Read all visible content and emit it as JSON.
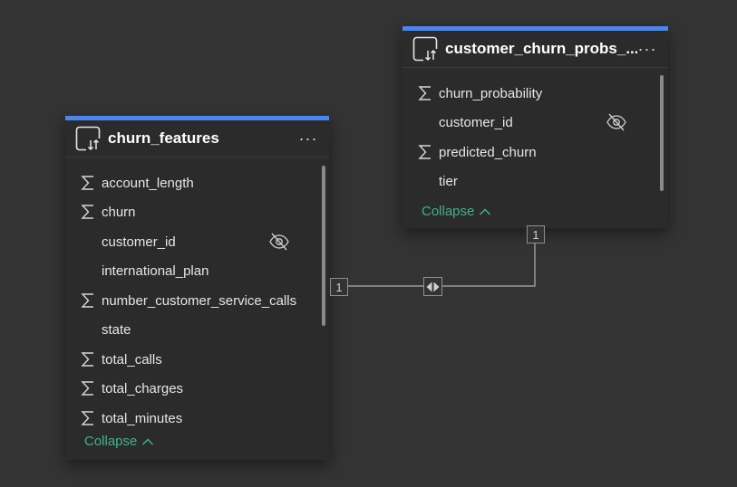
{
  "tables": [
    {
      "title": "churn_features",
      "more_label": "···",
      "fields": [
        {
          "label": "account_length",
          "icon": "sigma-icon",
          "hidden": false
        },
        {
          "label": "churn",
          "icon": "sigma-icon",
          "hidden": false
        },
        {
          "label": "customer_id",
          "icon": "",
          "hidden": true
        },
        {
          "label": "international_plan",
          "icon": "",
          "hidden": false
        },
        {
          "label": "number_customer_service_calls",
          "icon": "sigma-icon",
          "hidden": false
        },
        {
          "label": "state",
          "icon": "",
          "hidden": false
        },
        {
          "label": "total_calls",
          "icon": "sigma-icon",
          "hidden": false
        },
        {
          "label": "total_charges",
          "icon": "sigma-icon",
          "hidden": false
        },
        {
          "label": "total_minutes",
          "icon": "sigma-icon",
          "hidden": false
        }
      ],
      "collapse_label": "Collapse"
    },
    {
      "title": "customer_churn_probs_...",
      "more_label": "···",
      "fields": [
        {
          "label": "churn_probability",
          "icon": "sigma-icon",
          "hidden": false
        },
        {
          "label": "customer_id",
          "icon": "",
          "hidden": true
        },
        {
          "label": "predicted_churn",
          "icon": "sigma-icon",
          "hidden": false
        },
        {
          "label": "tier",
          "icon": "",
          "hidden": false
        }
      ],
      "collapse_label": "Collapse"
    }
  ],
  "relationship": {
    "from_cardinality": "1",
    "to_cardinality": "1",
    "cross_filter": "both-directions-icon"
  },
  "colors": {
    "accent": "#4a86f0",
    "collapse": "#3fb28a",
    "background": "#333333",
    "card": "#2b2b2b"
  }
}
